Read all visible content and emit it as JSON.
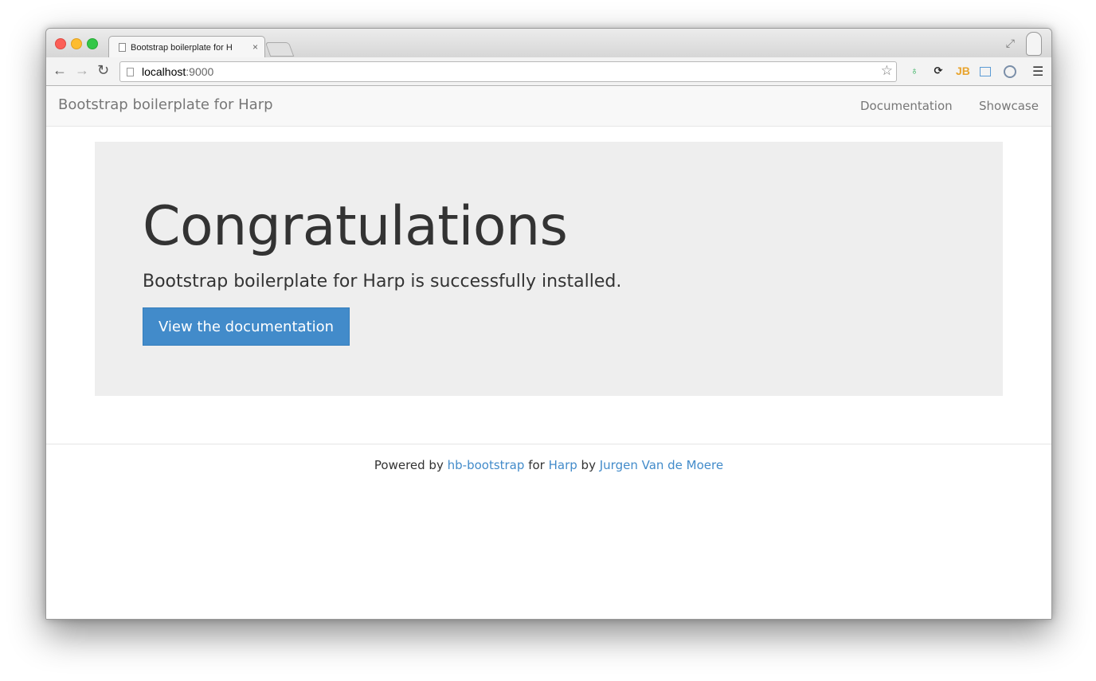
{
  "browser": {
    "tab_title": "Bootstrap boilerplate for H",
    "tab_close": "×",
    "url_host": "localhost",
    "url_port": ":9000"
  },
  "navbar": {
    "brand": "Bootstrap boilerplate for Harp",
    "links": [
      "Documentation",
      "Showcase"
    ]
  },
  "jumbotron": {
    "heading": "Congratulations",
    "lead": "Bootstrap boilerplate for Harp is successfully installed.",
    "button_label": "View the documentation",
    "background": "#eeeeee",
    "button_color": "#428bca"
  },
  "footer": {
    "prefix": "Powered by",
    "link1": "hb-bootstrap",
    "mid1": "for",
    "link2": "Harp",
    "mid2": "by",
    "link3": "Jurgen Van de Moere",
    "link_color": "#428bca"
  },
  "icons": {
    "back": "back-arrow-icon",
    "forward": "forward-arrow-icon",
    "reload": "reload-icon",
    "star": "bookmark-star-icon",
    "menu": "hamburger-menu-icon"
  }
}
